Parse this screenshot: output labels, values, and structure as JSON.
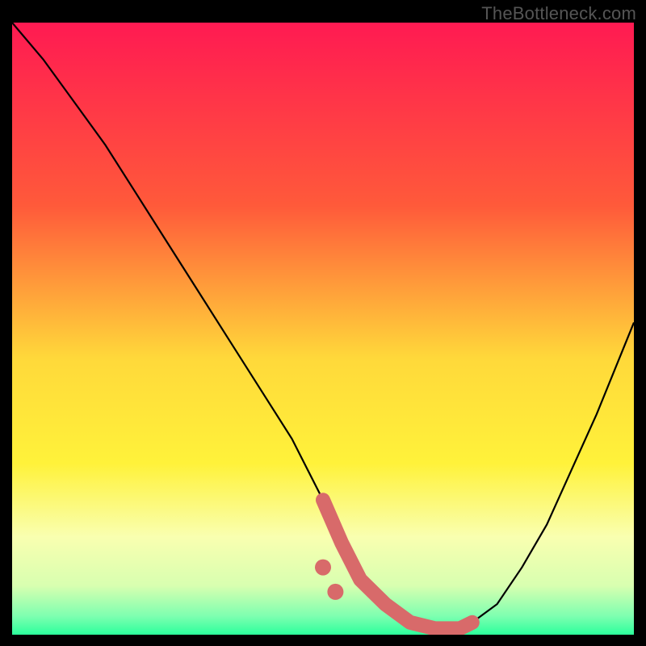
{
  "watermark": "TheBottleneck.com",
  "chart_data": {
    "type": "line",
    "title": "",
    "xlabel": "",
    "ylabel": "",
    "xlim": [
      0,
      100
    ],
    "ylim": [
      0,
      100
    ],
    "gradient_stops": [
      {
        "offset": 0,
        "color": "#ff1a52"
      },
      {
        "offset": 30,
        "color": "#ff5a3a"
      },
      {
        "offset": 55,
        "color": "#ffd93a"
      },
      {
        "offset": 72,
        "color": "#fff23a"
      },
      {
        "offset": 84,
        "color": "#f9ffb0"
      },
      {
        "offset": 92,
        "color": "#d8ffb0"
      },
      {
        "offset": 97,
        "color": "#7dffb0"
      },
      {
        "offset": 100,
        "color": "#2bff9c"
      }
    ],
    "series": [
      {
        "name": "curve",
        "color": "#000000",
        "x": [
          0,
          5,
          10,
          15,
          20,
          25,
          30,
          35,
          40,
          45,
          50,
          53,
          56,
          60,
          64,
          68,
          72,
          74,
          78,
          82,
          86,
          90,
          94,
          98,
          100
        ],
        "y": [
          100,
          94,
          87,
          80,
          72,
          64,
          56,
          48,
          40,
          32,
          22,
          15,
          9,
          5,
          2,
          1,
          1,
          2,
          5,
          11,
          18,
          27,
          36,
          46,
          51
        ]
      },
      {
        "name": "highlight-band",
        "color": "#d86a6a",
        "x": [
          50,
          53,
          56,
          60,
          64,
          68,
          72,
          74
        ],
        "y": [
          22,
          15,
          9,
          5,
          2,
          1,
          1,
          2
        ]
      }
    ],
    "highlight_dots": {
      "color": "#d86a6a",
      "points": [
        {
          "x": 50,
          "y": 11
        },
        {
          "x": 52,
          "y": 7
        }
      ]
    }
  }
}
